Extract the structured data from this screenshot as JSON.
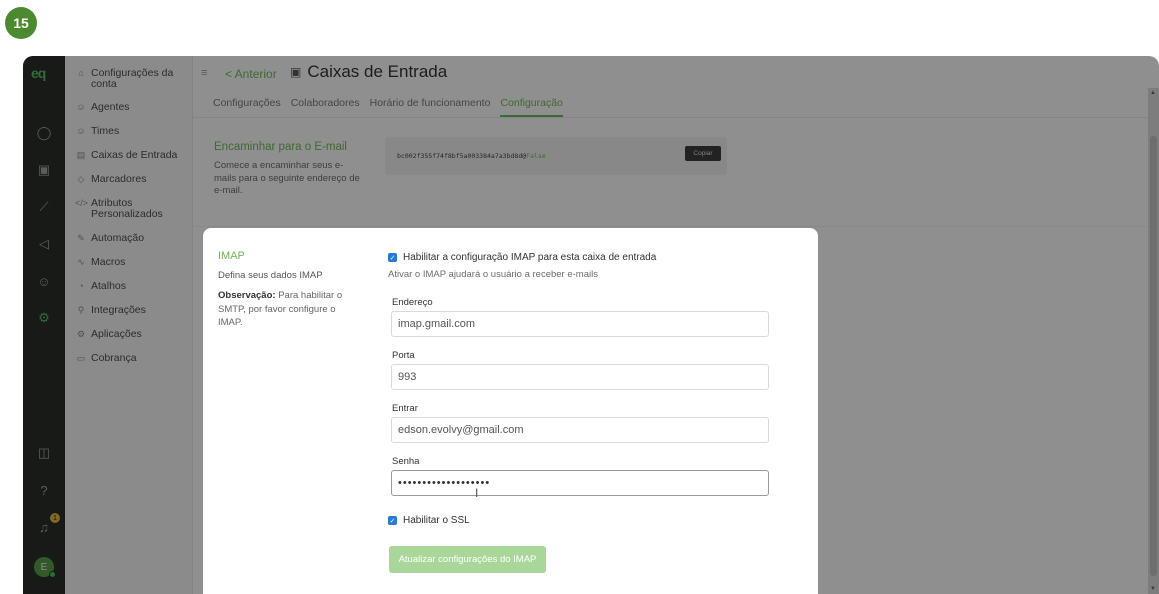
{
  "step": "15",
  "rail": {
    "logo": "eq",
    "icons": [
      "chat-icon",
      "inbox-icon",
      "reports-icon",
      "campaigns-icon",
      "contacts-icon",
      "settings-icon",
      "sidebar-toggle-icon",
      "help-icon",
      "bell-icon"
    ],
    "notification_count": "1",
    "avatar_initial": "E"
  },
  "settings_nav": {
    "items": [
      {
        "label": "Configurações da conta",
        "icon": "⌂"
      },
      {
        "label": "Agentes",
        "icon": "☺"
      },
      {
        "label": "Times",
        "icon": "☺"
      },
      {
        "label": "Caixas de Entrada",
        "icon": "▤"
      },
      {
        "label": "Marcadores",
        "icon": "◇"
      },
      {
        "label": "Atributos Personalizados",
        "icon": "</>"
      },
      {
        "label": "Automação",
        "icon": "✎"
      },
      {
        "label": "Macros",
        "icon": "∿"
      },
      {
        "label": "Atalhos",
        "icon": "◔"
      },
      {
        "label": "Integrações",
        "icon": "⚲"
      },
      {
        "label": "Aplicações",
        "icon": "⚙"
      },
      {
        "label": "Cobrança",
        "icon": "▭"
      }
    ]
  },
  "header": {
    "back_label": "< Anterior",
    "title": "Caixas de Entrada"
  },
  "tabs": [
    "Configurações",
    "Colaboradores",
    "Horário de funcionamento",
    "Configuração"
  ],
  "forward": {
    "title": "Encaminhar para o E-mail",
    "description": "Comece a encaminhar seus e-mails para o seguinte endereço de e-mail.",
    "address": "bc002f355f74f8bf5a003384a7a3bd8d@",
    "address_suffix": "False",
    "copy_label": "Copiar"
  },
  "modal": {
    "title": "IMAP",
    "subtitle": "Defina seus dados IMAP",
    "note_bold": "Observação:",
    "note_text": " Para habilitar o SMTP, por favor configure o IMAP.",
    "enable_label": "Habilitar a configuração IMAP para esta caixa de entrada",
    "enable_checked": true,
    "hint": "Ativar o IMAP ajudará o usuário a receber e-mails",
    "fields": {
      "address_label": "Endereço",
      "address_value": "imap.gmail.com",
      "port_label": "Porta",
      "port_value": "993",
      "login_label": "Entrar",
      "login_value": "edson.evolvy@gmail.com",
      "password_label": "Senha",
      "password_value": "•••••••••••••••••••"
    },
    "ssl_label": "Habilitar o SSL",
    "ssl_checked": true,
    "save_label": "Atualizar configurações do IMAP"
  },
  "colors": {
    "accent": "#6fb35a",
    "rail_bg": "#2a2e2a",
    "checkbox": "#2979d6",
    "button_disabled": "#a9d79a"
  }
}
